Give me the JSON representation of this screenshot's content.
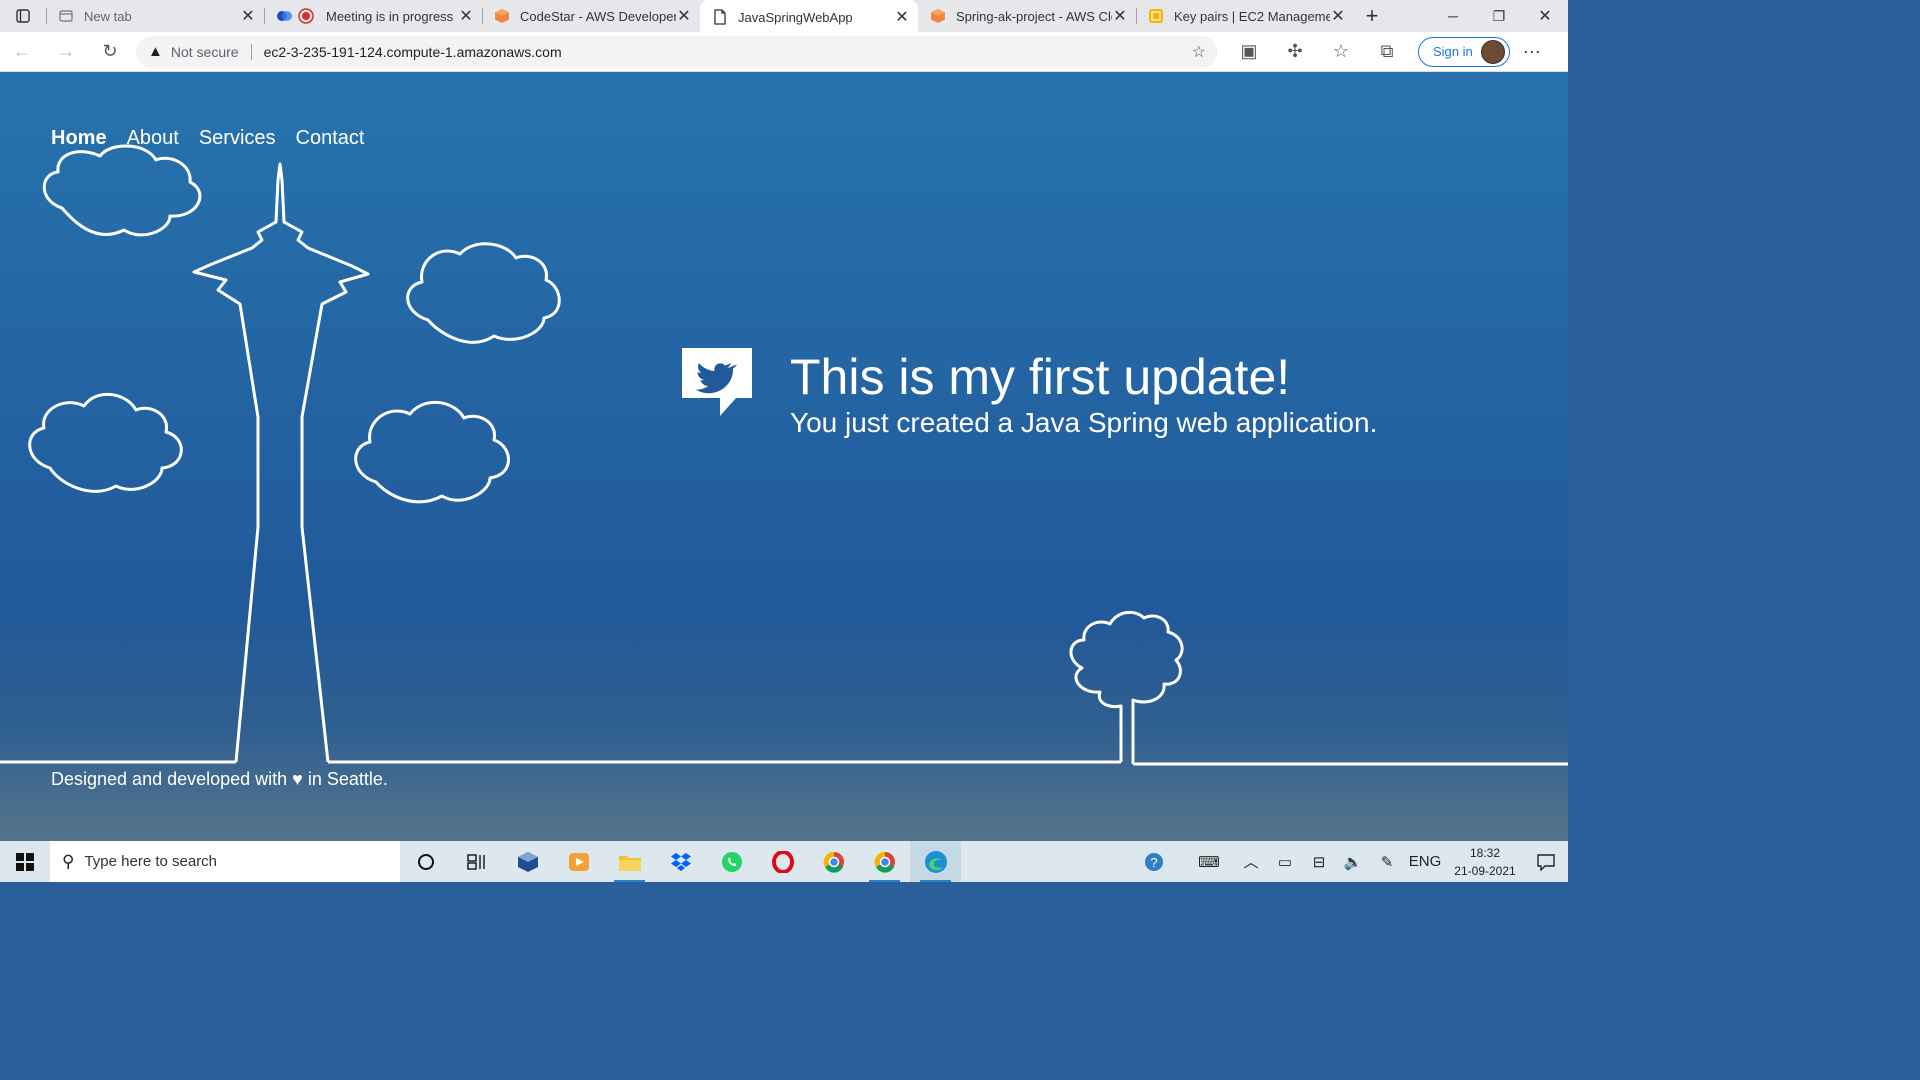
{
  "browser": {
    "tabs": [
      {
        "title": "New tab",
        "icon": "new-tab-icon",
        "active": false
      },
      {
        "title": "Meeting is in progress",
        "icon": "recording-icon",
        "active": false
      },
      {
        "title": "CodeStar - AWS Developer",
        "icon": "aws-cube-icon",
        "active": false
      },
      {
        "title": "JavaSpringWebApp",
        "icon": "page-icon",
        "active": true
      },
      {
        "title": "Spring-ak-project - AWS Clo",
        "icon": "aws-cube-icon",
        "active": false
      },
      {
        "title": "Key pairs | EC2 Managemen",
        "icon": "ec2-icon",
        "active": false
      }
    ],
    "new_tab_glyph": "+",
    "security_label": "Not secure",
    "url": "ec2-3-235-191-124.compute-1.amazonaws.com",
    "sign_in_label": "Sign in",
    "more_glyph": "···"
  },
  "page": {
    "nav": [
      {
        "label": "Home",
        "active": true
      },
      {
        "label": "About",
        "active": false
      },
      {
        "label": "Services",
        "active": false
      },
      {
        "label": "Contact",
        "active": false
      }
    ],
    "headline": "This is my first update!",
    "subheadline": "You just created a Java Spring web application.",
    "footer": "Designed and developed with ♥ in Seattle."
  },
  "taskbar": {
    "search_placeholder": "Type here to search",
    "language": "ENG",
    "time": "18:32",
    "date": "21-09-2021"
  },
  "colors": {
    "accent": "#1a73e8",
    "page_top": "#2673ad",
    "page_bottom": "#55748c",
    "taskbar": "#dce8ee"
  }
}
